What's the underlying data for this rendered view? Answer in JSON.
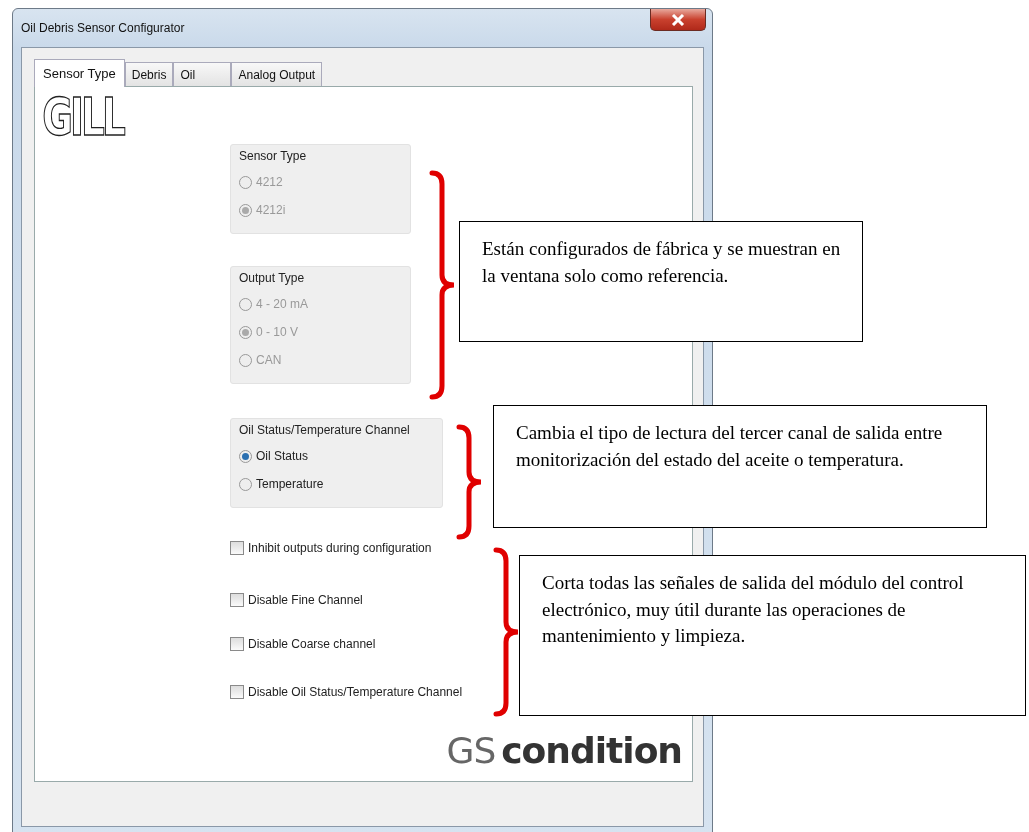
{
  "window": {
    "title": "Oil Debris Sensor Configurator"
  },
  "tabs": [
    {
      "label": "Sensor Type",
      "selected": true
    },
    {
      "label": "Debris",
      "selected": false
    },
    {
      "label": "Oil",
      "selected": false
    },
    {
      "label": "Analog Output",
      "selected": false
    }
  ],
  "logo": "GILL",
  "groups": [
    {
      "title": "Sensor Type",
      "disabled": true,
      "options": [
        {
          "label": "4212",
          "selected": false
        },
        {
          "label": "4212i",
          "selected": true
        }
      ]
    },
    {
      "title": "Output Type",
      "disabled": true,
      "options": [
        {
          "label": "4 - 20 mA",
          "selected": false
        },
        {
          "label": "0 - 10 V",
          "selected": true
        },
        {
          "label": "CAN",
          "selected": false
        }
      ]
    },
    {
      "title": "Oil Status/Temperature Channel",
      "disabled": false,
      "options": [
        {
          "label": "Oil Status",
          "selected": true
        },
        {
          "label": "Temperature",
          "selected": false
        }
      ]
    }
  ],
  "checkboxes": [
    {
      "label": "Inhibit outputs during configuration",
      "checked": false
    },
    {
      "label": "Disable Fine Channel",
      "checked": false
    },
    {
      "label": "Disable Coarse channel",
      "checked": false
    },
    {
      "label": "Disable Oil Status/Temperature Channel",
      "checked": false
    }
  ],
  "brand": {
    "first": "GS",
    "second": "condition"
  },
  "annotations": [
    {
      "text": "Están configurados de fábrica y se muestran en la ventana solo como referencia."
    },
    {
      "text": "Cambia el tipo de lectura del tercer canal de salida entre monitorización del estado del aceite o temperatura."
    },
    {
      "text": "Corta todas las señales de salida del módulo del control electrónico, muy útil durante las operaciones de mantenimiento y limpieza."
    }
  ]
}
